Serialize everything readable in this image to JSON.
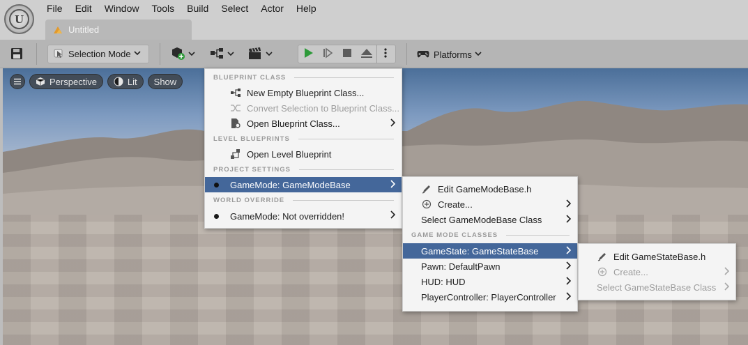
{
  "menubar": {
    "items": [
      "File",
      "Edit",
      "Window",
      "Tools",
      "Build",
      "Select",
      "Actor",
      "Help"
    ]
  },
  "tab": {
    "title": "Untitled"
  },
  "toolbar": {
    "mode_label": "Selection Mode",
    "platforms_label": "Platforms"
  },
  "viewport": {
    "perspective_label": "Perspective",
    "lit_label": "Lit",
    "show_label": "Show"
  },
  "blueprint_menu": {
    "section_blueprint_class": "BLUEPRINT CLASS",
    "new_empty": "New Empty Blueprint Class...",
    "convert_selection": "Convert Selection to Blueprint Class...",
    "open_blueprint": "Open Blueprint Class...",
    "section_level": "LEVEL BLUEPRINTS",
    "open_level": "Open Level Blueprint",
    "section_project": "PROJECT SETTINGS",
    "gamemode_project": "GameMode: GameModeBase",
    "section_world": "WORLD OVERRIDE",
    "gamemode_world": "GameMode: Not overridden!"
  },
  "gamemode_menu": {
    "edit": "Edit GameModeBase.h",
    "create": "Create...",
    "select_class": "Select GameModeBase Class",
    "section_classes": "GAME MODE CLASSES",
    "gamestate": "GameState: GameStateBase",
    "pawn": "Pawn: DefaultPawn",
    "hud": "HUD: HUD",
    "playercontroller": "PlayerController: PlayerController"
  },
  "gamestate_menu": {
    "edit": "Edit GameStateBase.h",
    "create": "Create...",
    "select_class": "Select GameStateBase Class"
  },
  "colors": {
    "highlight": "#44679a",
    "play_green": "#2e9a3a",
    "menu_bg": "#f4f4f4"
  }
}
